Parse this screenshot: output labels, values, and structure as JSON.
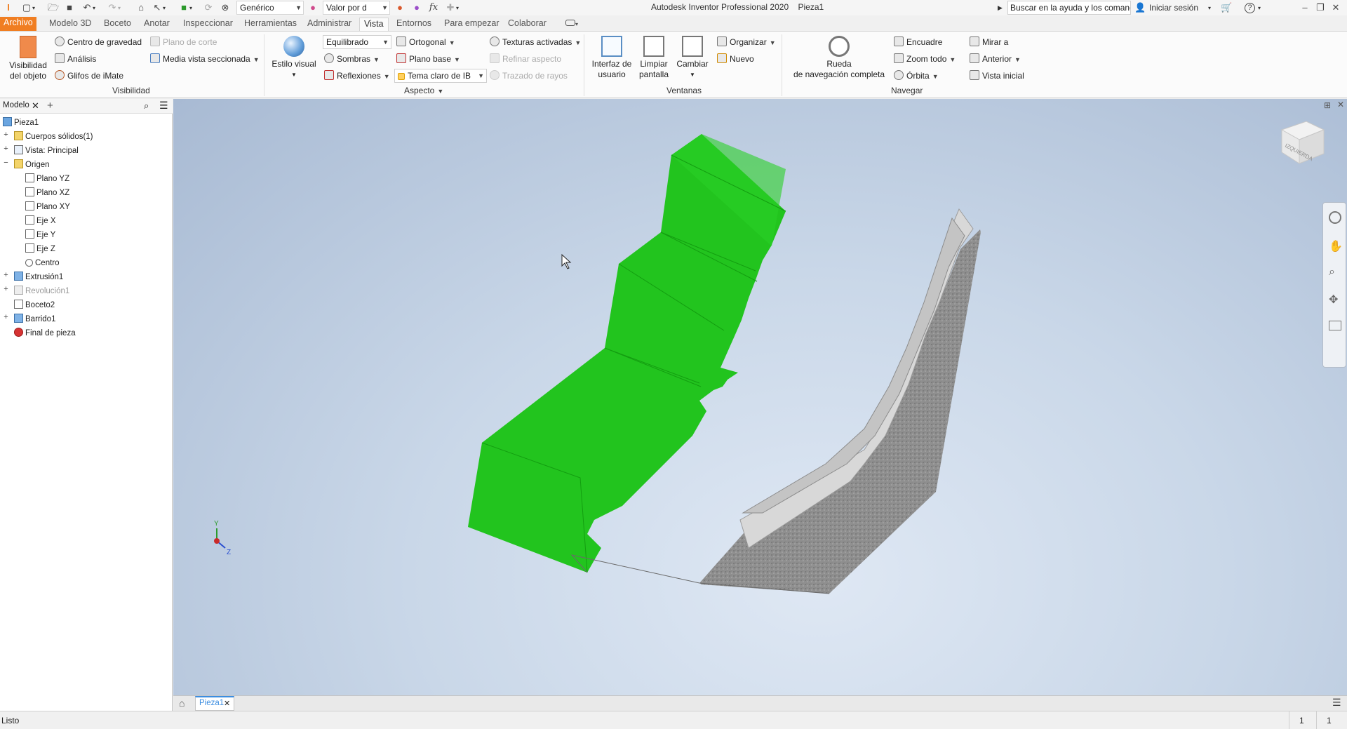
{
  "app": {
    "title": "Autodesk Inventor Professional 2020",
    "document": "Pieza1",
    "accent": "#f07e22"
  },
  "quickaccess": {
    "material": "Genérico",
    "appearance": "Valor por d"
  },
  "titlebar_right": {
    "help_search": "Buscar en la ayuda y los comanc",
    "signin": "Iniciar sesión"
  },
  "tabs": [
    "Archivo",
    "Modelo 3D",
    "Boceto",
    "Anotar",
    "Inspeccionar",
    "Herramientas",
    "Administrar",
    "Vista",
    "Entornos",
    "Para empezar",
    "Colaborar"
  ],
  "active_tab": "Vista",
  "ribbon": {
    "visibilidad": {
      "panel": "Visibilidad",
      "obj_vis_line1": "Visibilidad",
      "obj_vis_line2": "del objeto",
      "centro": "Centro de gravedad",
      "analisis": "Análisis",
      "glifos": "Glifos de iMate",
      "plano_corte": "Plano de corte",
      "media_vista": "Media vista seccionada"
    },
    "aspecto": {
      "panel": "Aspecto",
      "estilo": "Estilo visual",
      "equilibrado": "Equilibrado",
      "sombras": "Sombras",
      "reflexiones": "Reflexiones",
      "ortogonal": "Ortogonal",
      "plano_base": "Plano base",
      "tema": "Tema claro de IB",
      "texturas": "Texturas activadas",
      "refinar": "Refinar aspecto",
      "trazado": "Trazado de rayos"
    },
    "ventanas": {
      "panel": "Ventanas",
      "interfaz1": "Interfaz de",
      "interfaz2": "usuario",
      "limpiar1": "Limpiar",
      "limpiar2": "pantalla",
      "cambiar": "Cambiar",
      "organizar": "Organizar",
      "nuevo": "Nuevo"
    },
    "navegar": {
      "panel": "Navegar",
      "rueda1": "Rueda",
      "rueda2": "de navegación completa",
      "encuadre": "Encuadre",
      "zoom": "Zoom todo",
      "orbita": "Órbita",
      "mirar": "Mirar a",
      "anterior": "Anterior",
      "vista_inicial": "Vista inicial"
    }
  },
  "browser": {
    "tab": "Modelo",
    "items": [
      {
        "label": "Pieza1"
      },
      {
        "label": "Cuerpos sólidos(1)"
      },
      {
        "label": "Vista: Principal"
      },
      {
        "label": "Origen"
      },
      {
        "label": "Plano YZ"
      },
      {
        "label": "Plano XZ"
      },
      {
        "label": "Plano XY"
      },
      {
        "label": "Eje X"
      },
      {
        "label": "Eje Y"
      },
      {
        "label": "Eje Z"
      },
      {
        "label": "Centro"
      },
      {
        "label": "Extrusión1"
      },
      {
        "label": "Revolución1"
      },
      {
        "label": "Boceto2"
      },
      {
        "label": "Barrido1"
      },
      {
        "label": "Final de pieza"
      }
    ]
  },
  "viewcube_label": "IZQUIERDA",
  "triad": {
    "y": "Y",
    "z": "Z"
  },
  "doc_tab": "Pieza1",
  "status": {
    "text": "Listo",
    "n1": "1",
    "n2": "1"
  },
  "colors": {
    "model_green": "#22c41e",
    "concrete": "#8c8c8c"
  }
}
